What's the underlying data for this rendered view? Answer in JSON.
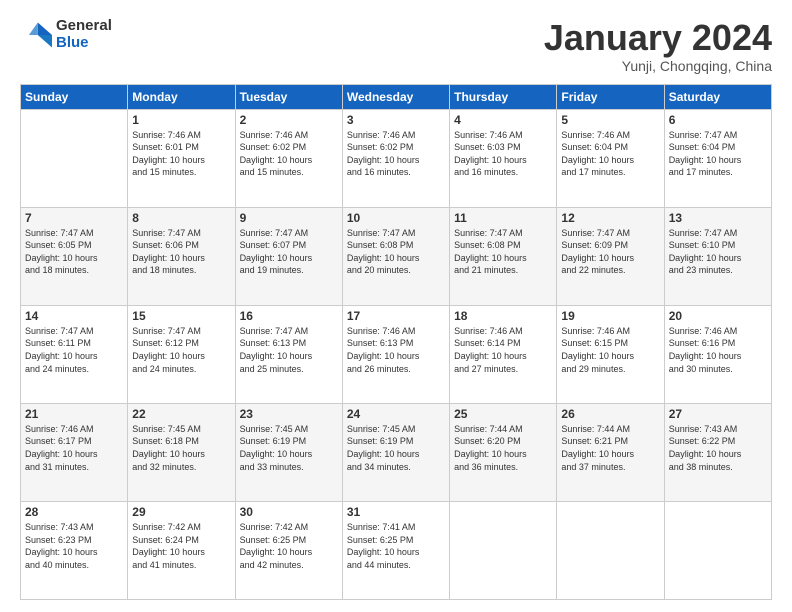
{
  "header": {
    "logo_general": "General",
    "logo_blue": "Blue",
    "month_title": "January 2024",
    "subtitle": "Yunji, Chongqing, China"
  },
  "days_of_week": [
    "Sunday",
    "Monday",
    "Tuesday",
    "Wednesday",
    "Thursday",
    "Friday",
    "Saturday"
  ],
  "weeks": [
    [
      {
        "day": "",
        "info": ""
      },
      {
        "day": "1",
        "info": "Sunrise: 7:46 AM\nSunset: 6:01 PM\nDaylight: 10 hours\nand 15 minutes."
      },
      {
        "day": "2",
        "info": "Sunrise: 7:46 AM\nSunset: 6:02 PM\nDaylight: 10 hours\nand 15 minutes."
      },
      {
        "day": "3",
        "info": "Sunrise: 7:46 AM\nSunset: 6:02 PM\nDaylight: 10 hours\nand 16 minutes."
      },
      {
        "day": "4",
        "info": "Sunrise: 7:46 AM\nSunset: 6:03 PM\nDaylight: 10 hours\nand 16 minutes."
      },
      {
        "day": "5",
        "info": "Sunrise: 7:46 AM\nSunset: 6:04 PM\nDaylight: 10 hours\nand 17 minutes."
      },
      {
        "day": "6",
        "info": "Sunrise: 7:47 AM\nSunset: 6:04 PM\nDaylight: 10 hours\nand 17 minutes."
      }
    ],
    [
      {
        "day": "7",
        "info": "Sunrise: 7:47 AM\nSunset: 6:05 PM\nDaylight: 10 hours\nand 18 minutes."
      },
      {
        "day": "8",
        "info": "Sunrise: 7:47 AM\nSunset: 6:06 PM\nDaylight: 10 hours\nand 18 minutes."
      },
      {
        "day": "9",
        "info": "Sunrise: 7:47 AM\nSunset: 6:07 PM\nDaylight: 10 hours\nand 19 minutes."
      },
      {
        "day": "10",
        "info": "Sunrise: 7:47 AM\nSunset: 6:08 PM\nDaylight: 10 hours\nand 20 minutes."
      },
      {
        "day": "11",
        "info": "Sunrise: 7:47 AM\nSunset: 6:08 PM\nDaylight: 10 hours\nand 21 minutes."
      },
      {
        "day": "12",
        "info": "Sunrise: 7:47 AM\nSunset: 6:09 PM\nDaylight: 10 hours\nand 22 minutes."
      },
      {
        "day": "13",
        "info": "Sunrise: 7:47 AM\nSunset: 6:10 PM\nDaylight: 10 hours\nand 23 minutes."
      }
    ],
    [
      {
        "day": "14",
        "info": "Sunrise: 7:47 AM\nSunset: 6:11 PM\nDaylight: 10 hours\nand 24 minutes."
      },
      {
        "day": "15",
        "info": "Sunrise: 7:47 AM\nSunset: 6:12 PM\nDaylight: 10 hours\nand 24 minutes."
      },
      {
        "day": "16",
        "info": "Sunrise: 7:47 AM\nSunset: 6:13 PM\nDaylight: 10 hours\nand 25 minutes."
      },
      {
        "day": "17",
        "info": "Sunrise: 7:46 AM\nSunset: 6:13 PM\nDaylight: 10 hours\nand 26 minutes."
      },
      {
        "day": "18",
        "info": "Sunrise: 7:46 AM\nSunset: 6:14 PM\nDaylight: 10 hours\nand 27 minutes."
      },
      {
        "day": "19",
        "info": "Sunrise: 7:46 AM\nSunset: 6:15 PM\nDaylight: 10 hours\nand 29 minutes."
      },
      {
        "day": "20",
        "info": "Sunrise: 7:46 AM\nSunset: 6:16 PM\nDaylight: 10 hours\nand 30 minutes."
      }
    ],
    [
      {
        "day": "21",
        "info": "Sunrise: 7:46 AM\nSunset: 6:17 PM\nDaylight: 10 hours\nand 31 minutes."
      },
      {
        "day": "22",
        "info": "Sunrise: 7:45 AM\nSunset: 6:18 PM\nDaylight: 10 hours\nand 32 minutes."
      },
      {
        "day": "23",
        "info": "Sunrise: 7:45 AM\nSunset: 6:19 PM\nDaylight: 10 hours\nand 33 minutes."
      },
      {
        "day": "24",
        "info": "Sunrise: 7:45 AM\nSunset: 6:19 PM\nDaylight: 10 hours\nand 34 minutes."
      },
      {
        "day": "25",
        "info": "Sunrise: 7:44 AM\nSunset: 6:20 PM\nDaylight: 10 hours\nand 36 minutes."
      },
      {
        "day": "26",
        "info": "Sunrise: 7:44 AM\nSunset: 6:21 PM\nDaylight: 10 hours\nand 37 minutes."
      },
      {
        "day": "27",
        "info": "Sunrise: 7:43 AM\nSunset: 6:22 PM\nDaylight: 10 hours\nand 38 minutes."
      }
    ],
    [
      {
        "day": "28",
        "info": "Sunrise: 7:43 AM\nSunset: 6:23 PM\nDaylight: 10 hours\nand 40 minutes."
      },
      {
        "day": "29",
        "info": "Sunrise: 7:42 AM\nSunset: 6:24 PM\nDaylight: 10 hours\nand 41 minutes."
      },
      {
        "day": "30",
        "info": "Sunrise: 7:42 AM\nSunset: 6:25 PM\nDaylight: 10 hours\nand 42 minutes."
      },
      {
        "day": "31",
        "info": "Sunrise: 7:41 AM\nSunset: 6:25 PM\nDaylight: 10 hours\nand 44 minutes."
      },
      {
        "day": "",
        "info": ""
      },
      {
        "day": "",
        "info": ""
      },
      {
        "day": "",
        "info": ""
      }
    ]
  ]
}
